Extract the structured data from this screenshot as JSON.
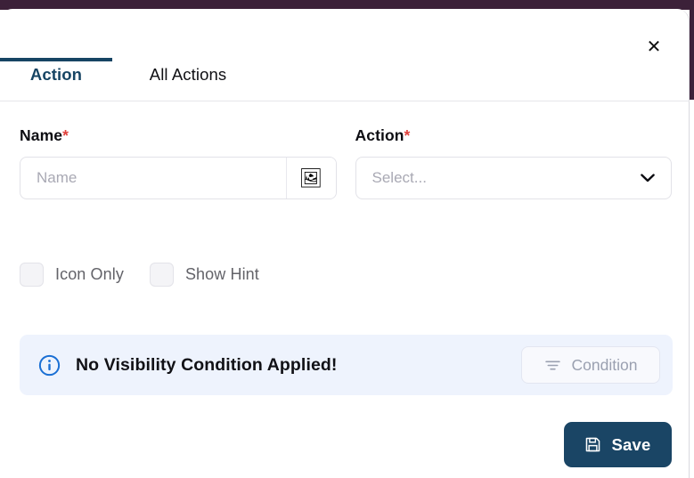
{
  "theme": {
    "backdrop": "#3C2139",
    "accent_navy": "#164463",
    "save_bg": "#1a4565",
    "required_red": "#e0413c",
    "banner_bg": "#eef3fd",
    "info_blue": "#1a6fd4"
  },
  "dialog": {
    "close_label": "✕"
  },
  "tabs": [
    {
      "label": "Action",
      "active": true
    },
    {
      "label": "All Actions",
      "active": false
    }
  ],
  "form": {
    "name_field": {
      "label": "Name",
      "required_marker": "*",
      "value": "",
      "placeholder": "Name",
      "addon_icon": "image-icon",
      "addon_glyph": "🖼"
    },
    "action_field": {
      "label": "Action",
      "required_marker": "*",
      "selected": "Select...",
      "options": []
    }
  },
  "checkboxes": [
    {
      "label": "Icon Only",
      "checked": false
    },
    {
      "label": "Show Hint",
      "checked": false
    }
  ],
  "banner": {
    "icon": "info-circle-icon",
    "message": "No Visibility Condition Applied!",
    "condition_button": {
      "label": "Condition",
      "icon": "filter-icon"
    }
  },
  "footer": {
    "save_button": {
      "label": "Save",
      "icon": "floppy-disk-save-icon"
    }
  }
}
